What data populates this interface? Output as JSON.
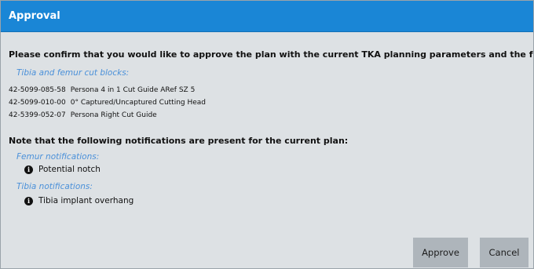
{
  "dialog": {
    "title": "Approval",
    "confirm_text": "Please confirm that you would like to approve the plan with the current TKA planning parameters and the following instrumentation:",
    "cut_blocks_label": "Tibia and femur cut blocks:",
    "parts": [
      {
        "number": "42-5099-085-58",
        "description": "Persona 4 in 1 Cut Guide ARef SZ 5"
      },
      {
        "number": "42-5099-010-00",
        "description": "0° Captured/Uncaptured Cutting Head"
      },
      {
        "number": "42-5399-052-07",
        "description": "Persona Right Cut Guide"
      }
    ],
    "notifications_title": "Note that the following notifications are present for the current plan:",
    "femur_label": "Femur notifications:",
    "femur_notification": "Potential notch",
    "tibia_label": "Tibia notifications:",
    "tibia_notification": "Tibia implant overhang",
    "info_icon_glyph": "i",
    "approve_label": "Approve",
    "cancel_label": "Cancel"
  },
  "colors": {
    "titlebar": "#1a86d6",
    "background": "#dde1e4",
    "section_label": "#4a90d9",
    "button": "#aeb5bb"
  }
}
